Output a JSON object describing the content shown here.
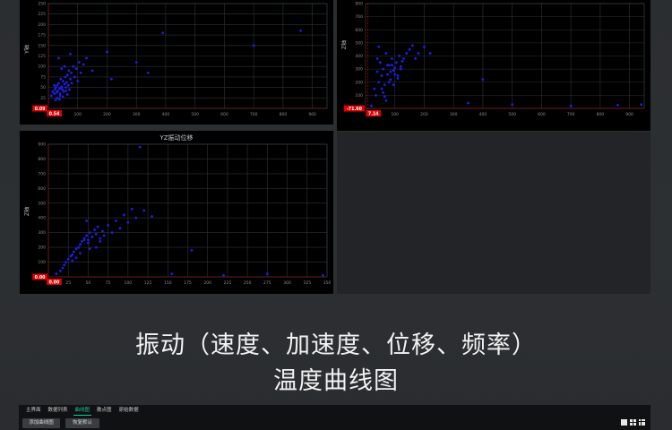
{
  "headline": {
    "line1": "振动（速度、加速度、位移、频率）",
    "line2": "温度曲线图"
  },
  "bottom_bar": {
    "tabs": [
      {
        "label": "主界面",
        "active": false
      },
      {
        "label": "数据列表",
        "active": false
      },
      {
        "label": "曲线图",
        "active": true
      },
      {
        "label": "散点图",
        "active": false
      },
      {
        "label": "原始数据",
        "active": false
      }
    ],
    "buttons": {
      "add_curve": "添加曲线图",
      "restore_default": "恢复默认"
    },
    "accent_color": "#23c48f",
    "layout_icons": [
      "layout-single-icon",
      "layout-quad-icon",
      "layout-nine-icon"
    ]
  },
  "chart_data": [
    {
      "type": "scatter",
      "title": "",
      "xlabel": "",
      "ylabel": "Y轴",
      "xlim": [
        0,
        950
      ],
      "ylim": [
        0,
        250
      ],
      "xticks": [
        "100",
        "200",
        "300",
        "400",
        "500",
        "600",
        "700",
        "800",
        "900"
      ],
      "yticks": [
        "0",
        "25",
        "50",
        "75",
        "100",
        "125",
        "150",
        "175",
        "200",
        "225",
        "250"
      ],
      "marker_x_label": "0.54",
      "marker_y_label": "0.09",
      "point_color": "#1e1ee6",
      "guide_color": "#c00000",
      "x": [
        10,
        15,
        20,
        22,
        25,
        28,
        30,
        32,
        35,
        38,
        40,
        42,
        45,
        48,
        50,
        52,
        55,
        58,
        60,
        62,
        65,
        68,
        70,
        72,
        75,
        78,
        80,
        85,
        90,
        95,
        100,
        105,
        110,
        120,
        130,
        150,
        200,
        215,
        300,
        340,
        390,
        700,
        860,
        30,
        40,
        50,
        60,
        35,
        45,
        55,
        25,
        65,
        75,
        20,
        42,
        38
      ],
      "y": [
        30,
        40,
        35,
        45,
        50,
        38,
        55,
        42,
        60,
        48,
        35,
        70,
        52,
        45,
        65,
        40,
        58,
        75,
        50,
        62,
        80,
        55,
        90,
        45,
        70,
        85,
        60,
        100,
        75,
        95,
        65,
        110,
        85,
        105,
        120,
        90,
        135,
        70,
        110,
        85,
        180,
        150,
        185,
        25,
        30,
        28,
        42,
        120,
        95,
        100,
        20,
        33,
        130,
        55,
        48,
        22
      ]
    },
    {
      "type": "scatter",
      "title": "",
      "xlabel": "",
      "ylabel": "Z轴",
      "xlim": [
        0,
        950
      ],
      "ylim": [
        0,
        800
      ],
      "xticks": [
        "100",
        "200",
        "300",
        "400",
        "500",
        "600",
        "700",
        "800",
        "900"
      ],
      "yticks": [
        "0",
        "100",
        "200",
        "300",
        "400",
        "500",
        "600",
        "700",
        "800"
      ],
      "marker_x_label": "7.14",
      "marker_y_label": "-71.60",
      "point_color": "#1e1ee6",
      "guide_color": "#c00000",
      "x": [
        20,
        30,
        35,
        40,
        45,
        50,
        55,
        60,
        65,
        70,
        75,
        80,
        85,
        90,
        95,
        100,
        105,
        110,
        115,
        120,
        125,
        130,
        140,
        150,
        160,
        170,
        180,
        200,
        220,
        350,
        400,
        500,
        700,
        860,
        940,
        40,
        60,
        80,
        100,
        55,
        75,
        95,
        65,
        85,
        45,
        120,
        110,
        70,
        90
      ],
      "y": [
        20,
        150,
        100,
        280,
        200,
        350,
        250,
        300,
        180,
        420,
        260,
        330,
        220,
        380,
        290,
        310,
        350,
        250,
        400,
        320,
        360,
        380,
        420,
        450,
        480,
        380,
        420,
        470,
        420,
        40,
        220,
        30,
        20,
        25,
        30,
        380,
        120,
        200,
        260,
        150,
        330,
        180,
        90,
        280,
        470,
        300,
        230,
        60,
        330
      ]
    },
    {
      "type": "scatter",
      "title": "YZ振动位移",
      "xlabel": "",
      "ylabel": "Z轴",
      "xlim": [
        0,
        350
      ],
      "ylim": [
        0,
        900
      ],
      "xticks": [
        "25",
        "50",
        "75",
        "100",
        "125",
        "150",
        "175",
        "200",
        "225",
        "250",
        "275",
        "300",
        "325",
        "350"
      ],
      "yticks": [
        "0",
        "100",
        "200",
        "300",
        "400",
        "500",
        "600",
        "700",
        "800",
        "900"
      ],
      "marker_x_label": "0.00",
      "marker_y_label": "0.00",
      "point_color": "#1e1ee6",
      "guide_color": "#c00000",
      "x": [
        10,
        15,
        18,
        20,
        22,
        25,
        28,
        30,
        32,
        35,
        38,
        40,
        42,
        45,
        48,
        50,
        52,
        55,
        58,
        60,
        62,
        65,
        68,
        70,
        75,
        80,
        85,
        90,
        95,
        100,
        105,
        110,
        115,
        120,
        130,
        155,
        180,
        220,
        275,
        345,
        40,
        50,
        60,
        45,
        55,
        35,
        65,
        30,
        48,
        52
      ],
      "y": [
        20,
        40,
        60,
        80,
        100,
        120,
        140,
        150,
        170,
        190,
        200,
        220,
        240,
        260,
        280,
        250,
        300,
        270,
        320,
        290,
        340,
        260,
        310,
        280,
        350,
        300,
        380,
        330,
        420,
        370,
        460,
        400,
        880,
        450,
        410,
        20,
        180,
        10,
        20,
        10,
        160,
        230,
        200,
        250,
        270,
        130,
        240,
        110,
        380,
        190
      ]
    }
  ]
}
